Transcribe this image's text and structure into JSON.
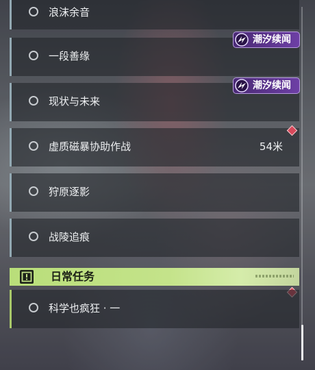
{
  "quests": [
    {
      "title": "浪沫余音"
    },
    {
      "title": "一段善缘"
    },
    {
      "title": "现状与未来"
    },
    {
      "title": "虚质磁暴协助作战",
      "distance": "54米"
    },
    {
      "title": "狩原逐影"
    },
    {
      "title": "战陵追痕"
    }
  ],
  "badge_label": "潮汐续闻",
  "daily_section": {
    "title": "日常任务",
    "quests": [
      {
        "title": "科学也疯狂 · 一"
      }
    ]
  },
  "colors": {
    "badge": "#5e3690",
    "section": "#c4e38a",
    "marker": "#d8485a",
    "accent_main": "#93a9b3",
    "accent_daily": "#a9c96a"
  }
}
